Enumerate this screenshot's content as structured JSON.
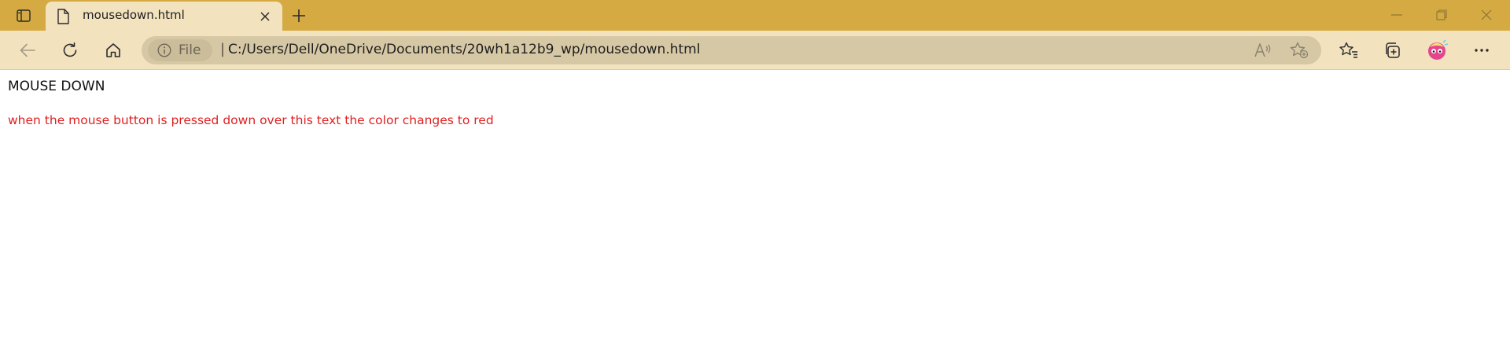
{
  "browser": {
    "tab": {
      "title": "mousedown.html"
    },
    "address_bar": {
      "site_label": "File",
      "separator": "|",
      "url": "C:/Users/Dell/OneDrive/Documents/20wh1a12b9_wp/mousedown.html"
    },
    "icons": {
      "tab_actions": "tab-actions-icon",
      "favicon": "document-icon",
      "close_tab": "close-icon",
      "new_tab": "plus-icon",
      "back": "back-arrow-icon",
      "refresh": "refresh-icon",
      "home": "home-icon",
      "info": "info-icon",
      "read_aloud": "read-aloud-icon",
      "add_favorite": "add-favorite-icon",
      "favorites": "favorites-icon",
      "collections": "collections-icon",
      "profile": "profile-avatar-icon",
      "more": "more-icon",
      "minimize": "minimize-icon",
      "restore": "restore-icon",
      "close_window": "close-window-icon"
    },
    "colors": {
      "tab_strip": "#d5aa42",
      "toolbar": "#f2e2be",
      "address_bar": "#d6c8a4"
    }
  },
  "page": {
    "heading": "MOUSE DOWN",
    "paragraph": "when the mouse button is pressed down over this text the color changes to red",
    "paragraph_color": "#e01f1f"
  }
}
